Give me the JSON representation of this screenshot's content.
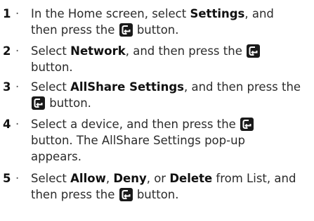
{
  "steps": [
    {
      "number": "1",
      "bullet": "·",
      "parts": {
        "a": "In the Home screen, select ",
        "b": "Settings",
        "c": ", and",
        "d": "then press the ",
        "e": " button."
      }
    },
    {
      "number": "2",
      "bullet": "·",
      "parts": {
        "a": "Select ",
        "b": "Network",
        "c": ", and then press the ",
        "d": "button."
      }
    },
    {
      "number": "3",
      "bullet": "·",
      "parts": {
        "a": "Select ",
        "b": "AllShare Settings",
        "c": ", and then press the",
        "d": " button."
      }
    },
    {
      "number": "4",
      "bullet": "·",
      "parts": {
        "a": "Select a device, and then press the ",
        "b": "button. The AllShare Settings pop-up",
        "c": "appears."
      }
    },
    {
      "number": "5",
      "bullet": "·",
      "parts": {
        "a": "Select ",
        "b": "Allow",
        "c": ", ",
        "d": "Deny",
        "e": ", or ",
        "f": "Delete",
        "g": " from List, and",
        "h": "then press the ",
        "i": " button."
      }
    }
  ],
  "icon": {
    "name": "enter-button-icon",
    "color": "#1a1a1a"
  }
}
